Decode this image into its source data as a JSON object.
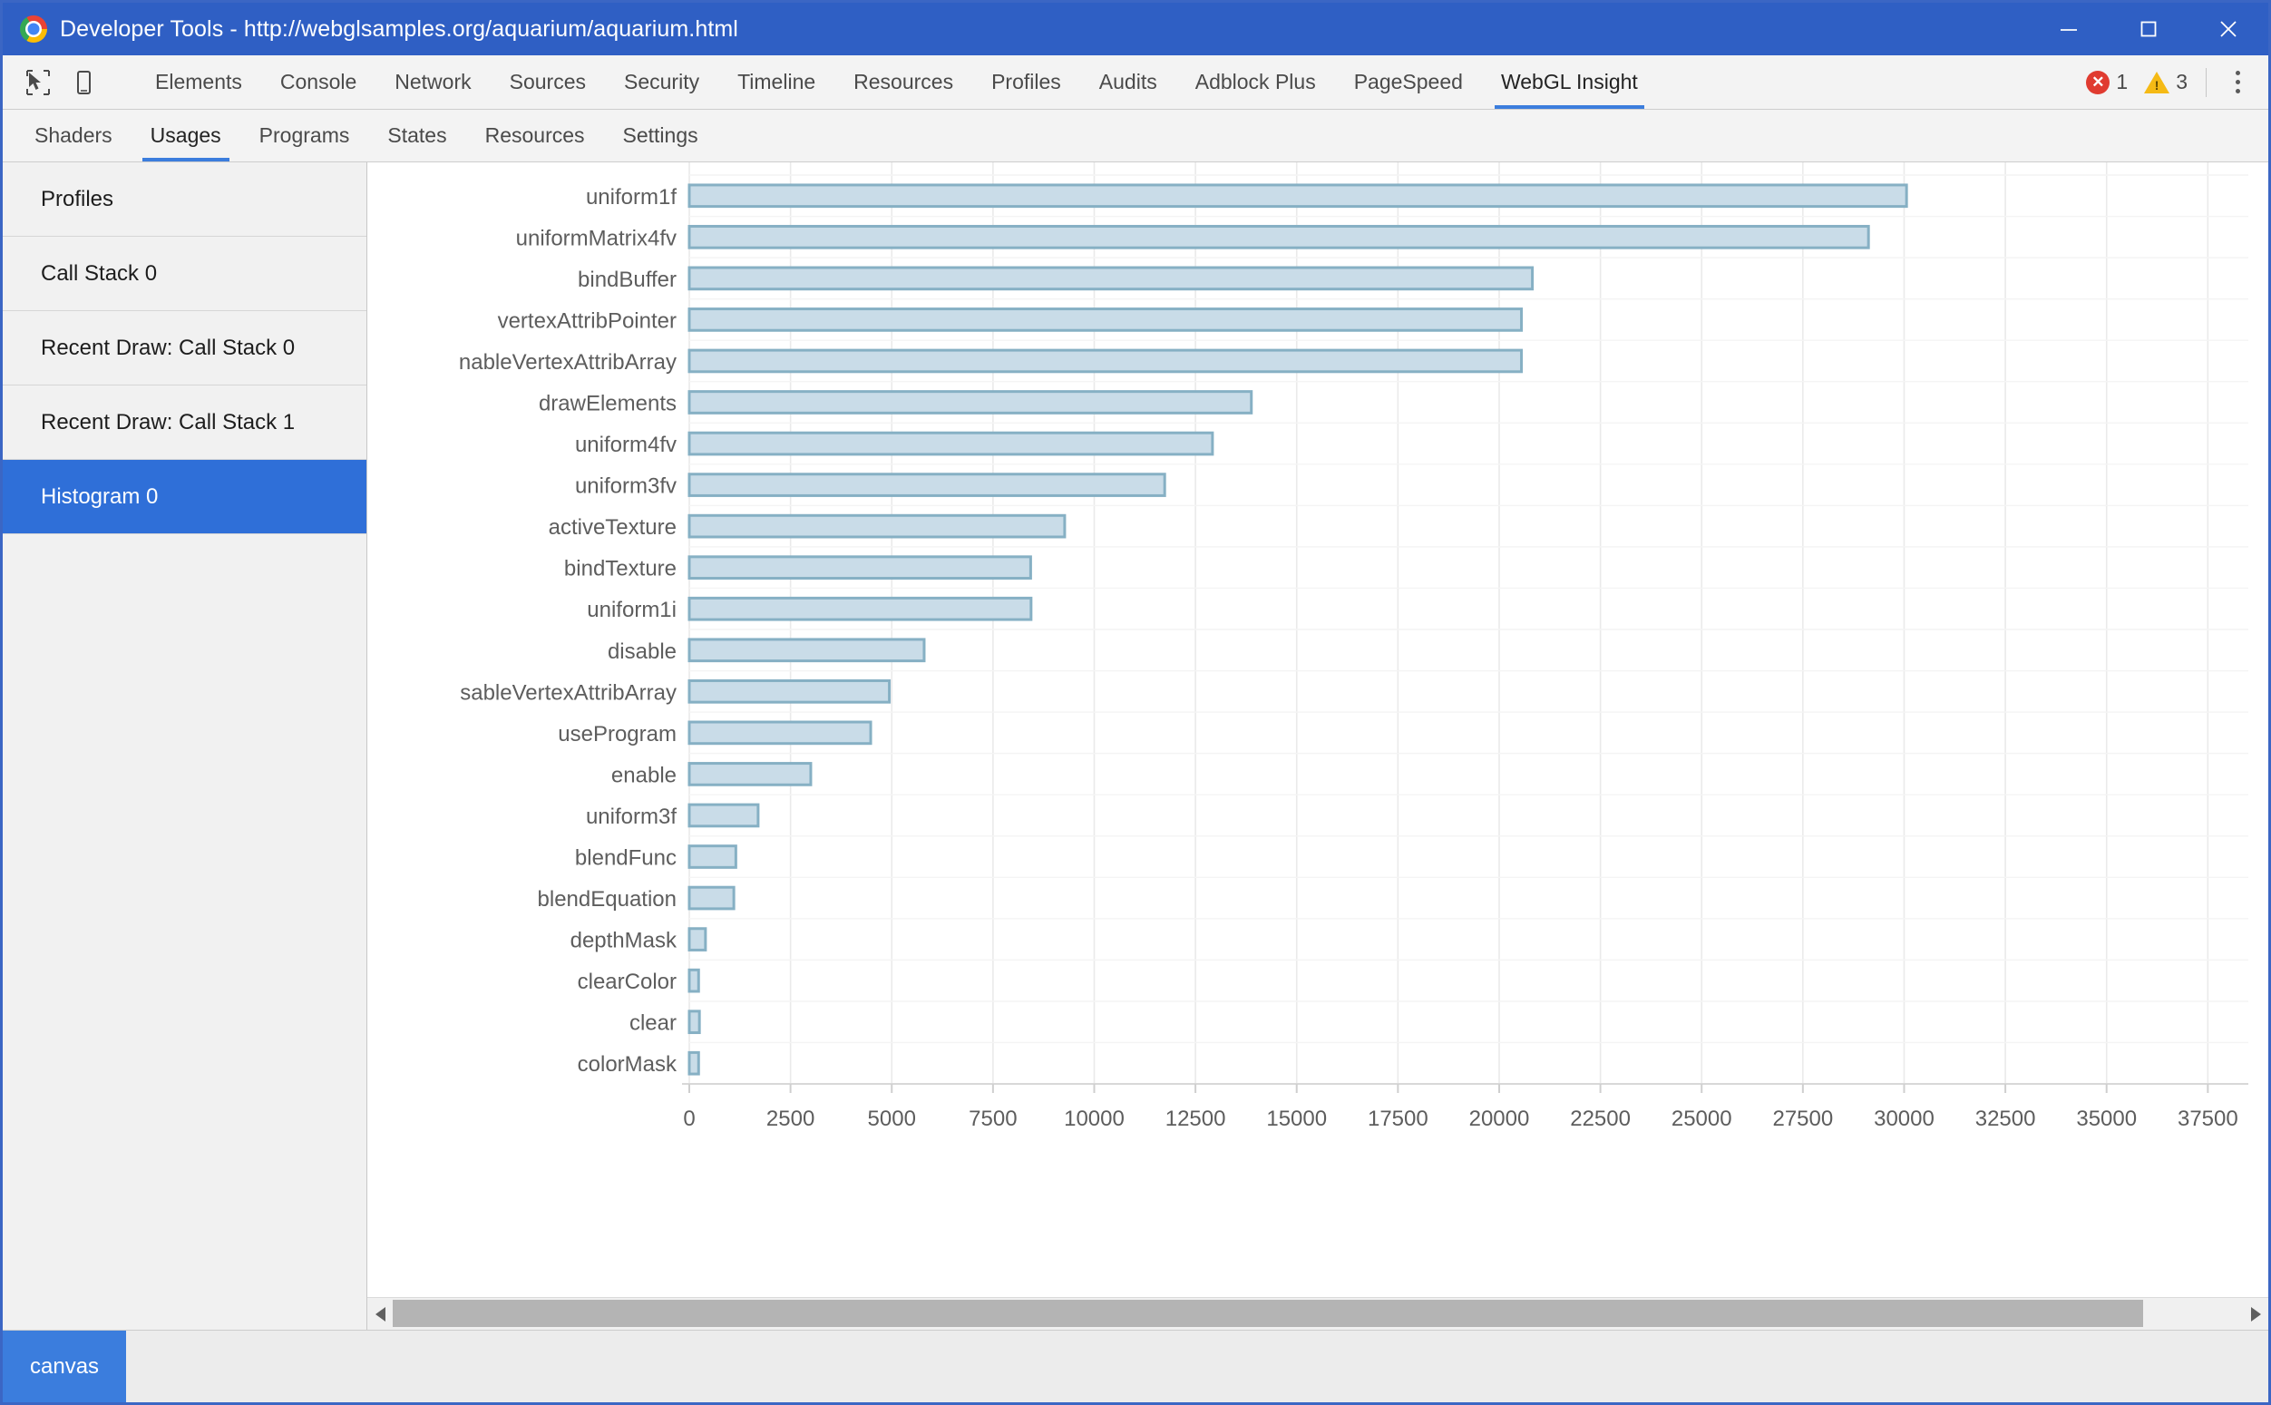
{
  "window": {
    "title": "Developer Tools - http://webglsamples.org/aquarium/aquarium.html",
    "logo_icon": "chrome-logo-icon",
    "minimize_icon": "minimize-icon",
    "maximize_icon": "maximize-icon",
    "close_icon": "close-icon",
    "titlebar_color": "#2f5fc4"
  },
  "toolbar": {
    "inspect_icon": "inspect-element-icon",
    "device_icon": "device-toolbar-icon",
    "tabs": [
      {
        "label": "Elements",
        "active": false
      },
      {
        "label": "Console",
        "active": false
      },
      {
        "label": "Network",
        "active": false
      },
      {
        "label": "Sources",
        "active": false
      },
      {
        "label": "Security",
        "active": false
      },
      {
        "label": "Timeline",
        "active": false
      },
      {
        "label": "Resources",
        "active": false
      },
      {
        "label": "Profiles",
        "active": false
      },
      {
        "label": "Audits",
        "active": false
      },
      {
        "label": "Adblock Plus",
        "active": false
      },
      {
        "label": "PageSpeed",
        "active": false
      },
      {
        "label": "WebGL Insight",
        "active": true
      }
    ],
    "errors_icon": "error-icon",
    "errors_count": "1",
    "warnings_icon": "warning-icon",
    "warnings_count": "3",
    "menu_icon": "kebab-menu-icon",
    "accent_color": "#3b7ddd"
  },
  "subtabs": [
    {
      "label": "Shaders",
      "active": false
    },
    {
      "label": "Usages",
      "active": true
    },
    {
      "label": "Programs",
      "active": false
    },
    {
      "label": "States",
      "active": false
    },
    {
      "label": "Resources",
      "active": false
    },
    {
      "label": "Settings",
      "active": false
    }
  ],
  "sidebar": {
    "items": [
      {
        "label": "Profiles",
        "selected": false
      },
      {
        "label": "Call Stack 0",
        "selected": false
      },
      {
        "label": "Recent Draw: Call Stack 0",
        "selected": false
      },
      {
        "label": "Recent Draw: Call Stack 1",
        "selected": false
      },
      {
        "label": "Histogram 0",
        "selected": true
      }
    ],
    "selected_color": "#2f6fd8"
  },
  "scrollbar": {
    "left_arrow_icon": "scroll-left-arrow-icon",
    "right_arrow_icon": "scroll-right-arrow-icon"
  },
  "bottombar": {
    "canvas_label": "canvas"
  },
  "chart_data": {
    "type": "bar",
    "orientation": "horizontal",
    "title": "",
    "xlabel": "",
    "ylabel": "",
    "xlim": [
      0,
      38500
    ],
    "xticks": [
      0,
      2500,
      5000,
      7500,
      10000,
      12500,
      15000,
      17500,
      20000,
      22500,
      25000,
      27500,
      30000,
      32500,
      35000,
      37500
    ],
    "xticklabels": [
      "0",
      "2500",
      "5000",
      "7500",
      "10000",
      "12500",
      "15000",
      "17500",
      "20000",
      "22500",
      "25000",
      "27500",
      "30000",
      "32500",
      "35000",
      "37500"
    ],
    "grid": true,
    "legend": null,
    "bar_fill": "#c9dce8",
    "bar_stroke": "#86b0c4",
    "categories": [
      "uniform1f",
      "uniformMatrix4fv",
      "bindBuffer",
      "vertexAttribPointer",
      "enableVertexAttribArray",
      "drawElements",
      "uniform4fv",
      "uniform3fv",
      "activeTexture",
      "bindTexture",
      "uniform1i",
      "disable",
      "disableVertexAttribArray",
      "useProgram",
      "enable",
      "uniform3f",
      "blendFunc",
      "blendEquation",
      "depthMask",
      "clearColor",
      "clear",
      "colorMask"
    ],
    "displayed_labels": [
      "uniform1f",
      "uniformMatrix4fv",
      "bindBuffer",
      "vertexAttribPointer",
      "nableVertexAttribArray",
      "drawElements",
      "uniform4fv",
      "uniform3fv",
      "activeTexture",
      "bindTexture",
      "uniform1i",
      "disable",
      "sableVertexAttribArray",
      "useProgram",
      "enable",
      "uniform3f",
      "blendFunc",
      "blendEquation",
      "depthMask",
      "clearColor",
      "clear",
      "colorMask"
    ],
    "values": [
      30060,
      29120,
      20820,
      20550,
      20550,
      13880,
      12920,
      11740,
      9270,
      8430,
      8440,
      5800,
      4940,
      4480,
      3000,
      1700,
      1150,
      1100,
      400,
      230,
      250,
      230
    ]
  }
}
